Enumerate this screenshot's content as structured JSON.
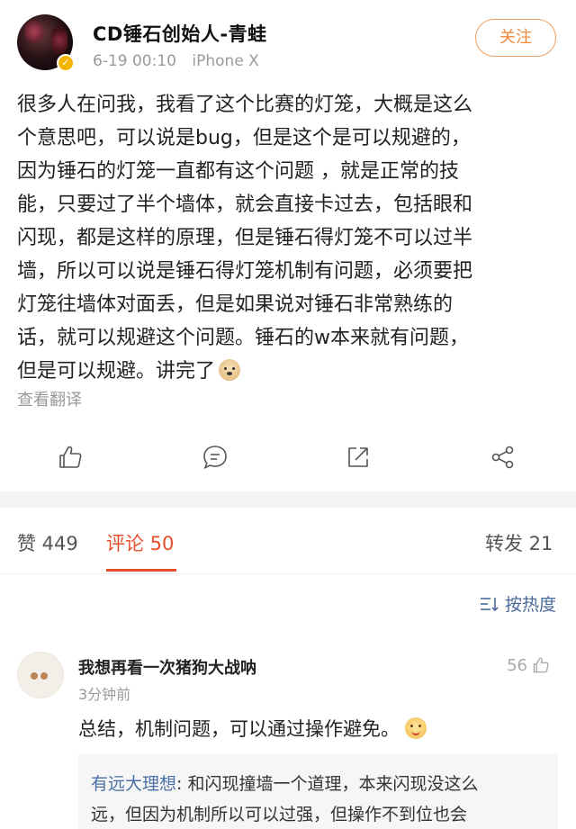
{
  "post": {
    "author": "CD锤石创始人-青蛙",
    "time": "6-19 00:10",
    "device": "iPhone X",
    "verified_badge": "✓",
    "follow_label": "关注",
    "body_lines": [
      "很多人在问我，我看了这个比赛的灯笼，大概是这么",
      "个意思吧，可以说是bug，但是这个是可以规避的，",
      "因为锤石的灯笼一直都有这个问题 ，就是正常的技",
      "能，只要过了半个墙体，就会直接卡过去，包括眼和",
      "闪现，都是这样的原理，但是锤石得灯笼不可以过半",
      "墙，所以可以说是锤石得灯笼机制有问题，必须要把",
      "灯笼往墙体对面丢，但是如果说对锤石非常熟练的",
      "话，就可以规避这个问题。锤石的w本来就有问题，",
      "但是可以规避。讲完了"
    ],
    "translate_label": "查看翻译"
  },
  "actions": [
    {
      "name": "like-icon"
    },
    {
      "name": "comment-icon"
    },
    {
      "name": "repost-icon"
    },
    {
      "name": "share-icon"
    }
  ],
  "tabs": {
    "likes": "赞 449",
    "comments": "评论 50",
    "reposts": "转发 21"
  },
  "sort": {
    "label": "按热度"
  },
  "comment": {
    "author": "我想再看一次猪狗大战呐",
    "time": "3分钟前",
    "likes": "56",
    "text": "总结，机制问题，可以通过操作避免。",
    "reply": {
      "author": "有远大理想",
      "line1": ": 和闪现撞墙一个道理，本来闪现没这么",
      "line2": "远，但因为机制所以可以过强，但操作不到位也会"
    }
  },
  "colors": {
    "accent": "#e8502b",
    "follow": "#f08a3c",
    "link": "#4a6fa5"
  }
}
